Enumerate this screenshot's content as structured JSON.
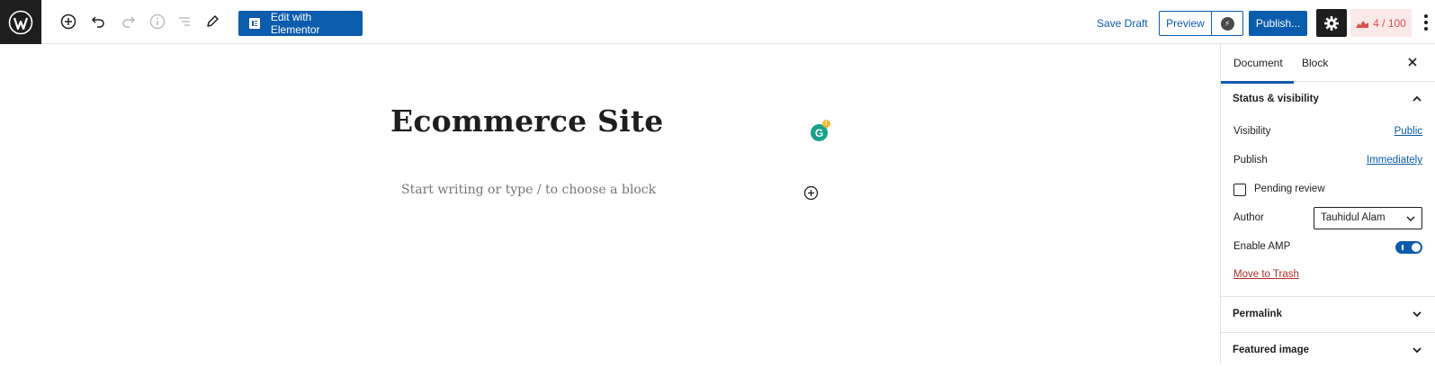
{
  "toolbar": {
    "wp_logo": "wordpress-logo",
    "elementor_label": "Edit with Elementor",
    "save_draft_label": "Save Draft",
    "preview_label": "Preview",
    "publish_label": "Publish...",
    "score_label": "4 / 100"
  },
  "editor": {
    "title": "Ecommerce Site",
    "block_placeholder": "Start writing or type / to choose a block",
    "grammarly_letter": "G",
    "grammarly_count": "1"
  },
  "sidebar": {
    "tabs": [
      {
        "label": "Document",
        "active": true
      },
      {
        "label": "Block",
        "active": false
      }
    ],
    "status_panel": {
      "title": "Status & visibility",
      "visibility_label": "Visibility",
      "visibility_value": "Public",
      "publish_label": "Publish",
      "publish_value": "Immediately",
      "pending_review_label": "Pending review",
      "author_label": "Author",
      "author_value": "Tauhidul Alam",
      "amp_label": "Enable AMP",
      "amp_enabled": true,
      "trash_label": "Move to Trash"
    },
    "permalink_title": "Permalink",
    "featured_image_title": "Featured image"
  },
  "colors": {
    "accent": "#0b5cad",
    "dark": "#1e1e1e",
    "danger": "#b32d2e",
    "score_bg": "#fbe9e9",
    "score_text": "#d94f4f"
  }
}
